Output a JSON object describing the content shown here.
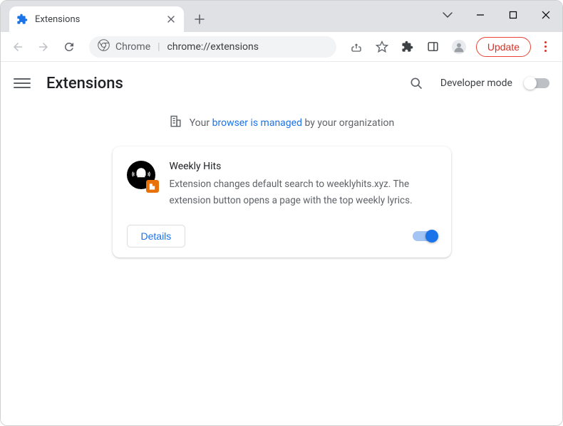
{
  "tab": {
    "title": "Extensions"
  },
  "omnibox": {
    "scheme": "Chrome",
    "path": "chrome://extensions"
  },
  "toolbar": {
    "update_label": "Update"
  },
  "page": {
    "title": "Extensions",
    "dev_mode_label": "Developer mode",
    "banner_prefix": "Your ",
    "banner_link": "browser is managed",
    "banner_suffix": " by your organization"
  },
  "extension": {
    "name": "Weekly Hits",
    "description": "Extension changes default search to weeklyhits.xyz. The extension button opens a page with the top weekly lyrics.",
    "details_label": "Details"
  }
}
